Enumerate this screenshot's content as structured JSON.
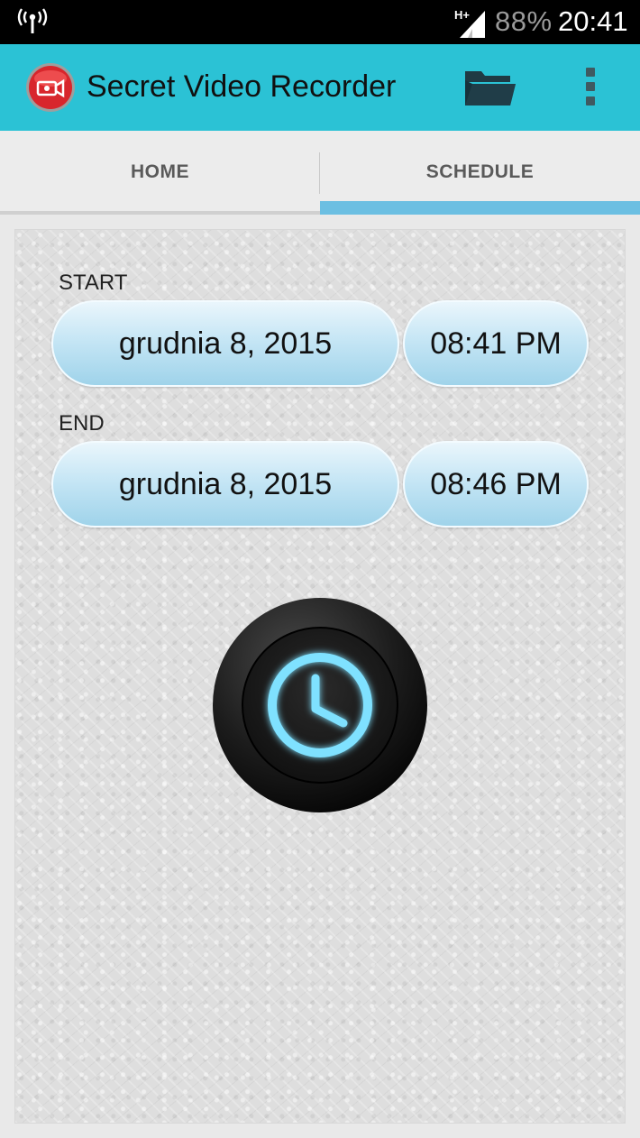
{
  "status_bar": {
    "network_type": "H+",
    "battery": "88%",
    "time": "20:41",
    "icons": [
      "antenna-icon",
      "signal-icon"
    ]
  },
  "app_bar": {
    "title": "Secret Video Recorder",
    "icons": [
      "app-logo-icon",
      "folder-icon",
      "overflow-menu-icon"
    ],
    "accent_color": "#2bc2d5"
  },
  "tabs": [
    {
      "label": "HOME",
      "selected": false
    },
    {
      "label": "SCHEDULE",
      "selected": true
    }
  ],
  "schedule": {
    "start": {
      "label": "START",
      "date": "grudnia 8, 2015",
      "time": "08:41 PM"
    },
    "end": {
      "label": "END",
      "date": "grudnia 8, 2015",
      "time": "08:46 PM"
    },
    "action_icon": "clock-icon",
    "indicator_color": "#6cbfe2"
  }
}
